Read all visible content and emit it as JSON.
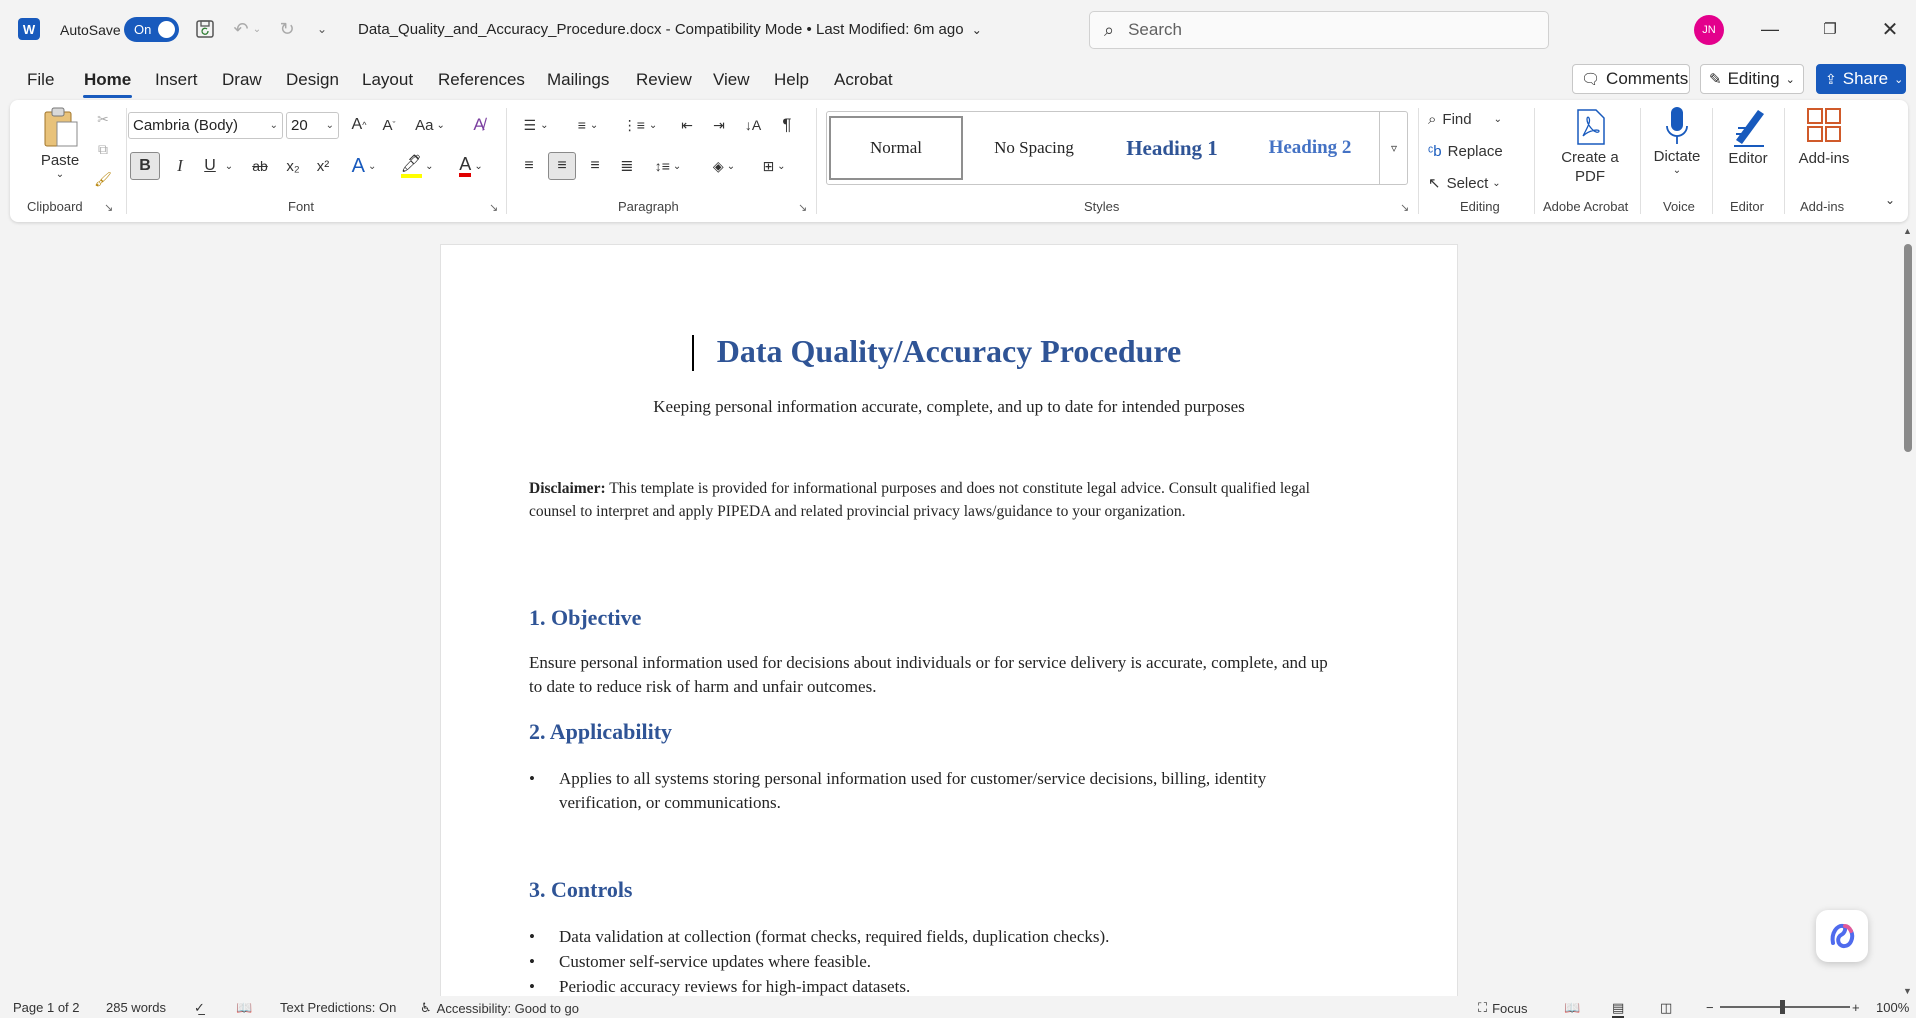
{
  "titlebar": {
    "app_logo": "W",
    "autosave_label": "AutoSave",
    "autosave_state": "On",
    "document_title": "Data_Quality_and_Accuracy_Procedure.docx  -  Compatibility Mode  •  Last Modified: 6m ago",
    "search_placeholder": "Search",
    "user_initials": "JN"
  },
  "menu": {
    "tabs": [
      "File",
      "Home",
      "Insert",
      "Draw",
      "Design",
      "Layout",
      "References",
      "Mailings",
      "Review",
      "View",
      "Help",
      "Acrobat"
    ],
    "active_tab": "Home",
    "comments_label": "Comments",
    "editing_label": "Editing",
    "share_label": "Share"
  },
  "ribbon": {
    "clipboard": {
      "paste_label": "Paste",
      "group_label": "Clipboard"
    },
    "font": {
      "font_name": "Cambria (Body)",
      "font_size": "20",
      "group_label": "Font",
      "bold": "B",
      "italic": "I",
      "underline": "U",
      "strike": "ab",
      "subscript": "x₂",
      "superscript": "x²",
      "change_case": "Aa"
    },
    "paragraph": {
      "group_label": "Paragraph"
    },
    "styles": {
      "group_label": "Styles",
      "items": [
        "Normal",
        "No Spacing",
        "Heading 1",
        "Heading 2"
      ]
    },
    "editing": {
      "find_label": "Find",
      "replace_label": "Replace",
      "select_label": "Select",
      "group_label": "Editing"
    },
    "acrobat": {
      "create_pdf_label": "Create a PDF",
      "group_label": "Adobe Acrobat"
    },
    "voice": {
      "dictate_label": "Dictate",
      "group_label": "Voice"
    },
    "editor": {
      "editor_label": "Editor",
      "group_label": "Editor"
    },
    "addins": {
      "addins_label": "Add-ins",
      "group_label": "Add-ins"
    }
  },
  "document": {
    "title": "Data Quality/Accuracy Procedure",
    "subtitle": "Keeping personal information accurate, complete, and up to date for intended purposes",
    "disclaimer_label": "Disclaimer:",
    "disclaimer_text": " This template is provided for informational purposes and does not constitute legal advice. Consult qualified legal counsel to interpret and apply PIPEDA and related provincial privacy laws/guidance to your organization.",
    "section1_heading": "1. Objective",
    "section1_body": "Ensure personal information used for decisions about individuals or for service delivery is accurate, complete, and up to date to reduce risk of harm and unfair outcomes.",
    "section2_heading": "2. Applicability",
    "section2_bullets": [
      "Applies to all systems storing personal information used for customer/service decisions, billing, identity verification, or communications."
    ],
    "section3_heading": "3. Controls",
    "section3_bullets": [
      "Data validation at collection (format checks, required fields, duplication checks).",
      "Customer self-service updates where feasible.",
      "Periodic accuracy reviews for high-impact datasets."
    ]
  },
  "statusbar": {
    "page": "Page 1 of 2",
    "words": "285 words",
    "text_predictions": "Text Predictions: On",
    "accessibility": "Accessibility: Good to go",
    "focus": "Focus",
    "zoom": "100%"
  },
  "colors": {
    "accent": "#185abd",
    "heading": "#2f5496",
    "avatar": "#e3008c"
  }
}
